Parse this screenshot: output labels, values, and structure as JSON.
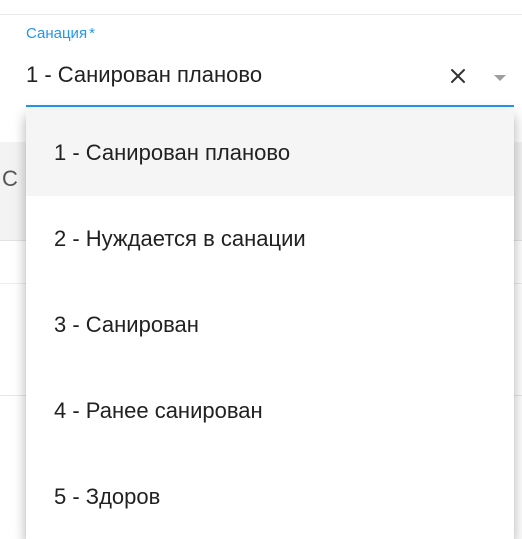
{
  "field": {
    "label": "Санация",
    "required_mark": "*",
    "value": "1 - Санирован планово",
    "clear_icon": "close-icon",
    "dropdown_icon": "caret-down-icon"
  },
  "background": {
    "partial_text": "С"
  },
  "menu": {
    "selected_index": 0,
    "items": [
      {
        "label": "1 - Санирован планово"
      },
      {
        "label": "2 - Нуждается в санации"
      },
      {
        "label": "3 - Санирован"
      },
      {
        "label": "4 - Ранее санирован"
      },
      {
        "label": "5 - Здоров"
      }
    ]
  },
  "colors": {
    "accent": "#2196f3",
    "text": "#212121",
    "selected_bg": "#f5f5f5"
  }
}
